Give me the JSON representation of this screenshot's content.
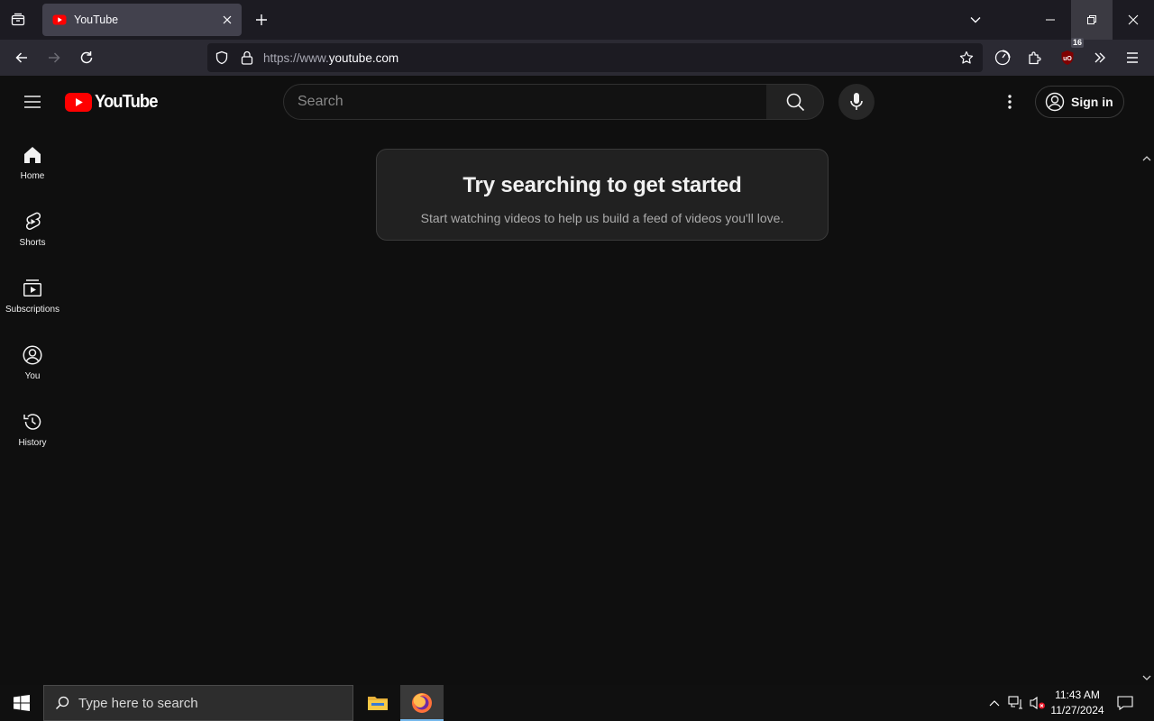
{
  "browser": {
    "tab": {
      "title": "YouTube"
    },
    "url": {
      "prefix": "https://www.",
      "domain": "youtube.com"
    },
    "extension_badge": "16"
  },
  "youtube": {
    "logo_text": "YouTube",
    "search": {
      "placeholder": "Search"
    },
    "signin_label": "Sign in",
    "sidebar": {
      "items": [
        {
          "label": "Home",
          "icon": "home-icon"
        },
        {
          "label": "Shorts",
          "icon": "shorts-icon"
        },
        {
          "label": "Subscriptions",
          "icon": "subscriptions-icon"
        },
        {
          "label": "You",
          "icon": "you-icon"
        },
        {
          "label": "History",
          "icon": "history-icon"
        }
      ]
    },
    "prompt": {
      "title": "Try searching to get started",
      "subtitle": "Start watching videos to help us build a feed of videos you'll love."
    }
  },
  "taskbar": {
    "search_placeholder": "Type here to search",
    "time": "11:43 AM",
    "date": "11/27/2024"
  },
  "colors": {
    "youtube_red": "#ff0000",
    "background": "#0f0f0f",
    "taskbar_active_underline": "#76b9ed"
  }
}
